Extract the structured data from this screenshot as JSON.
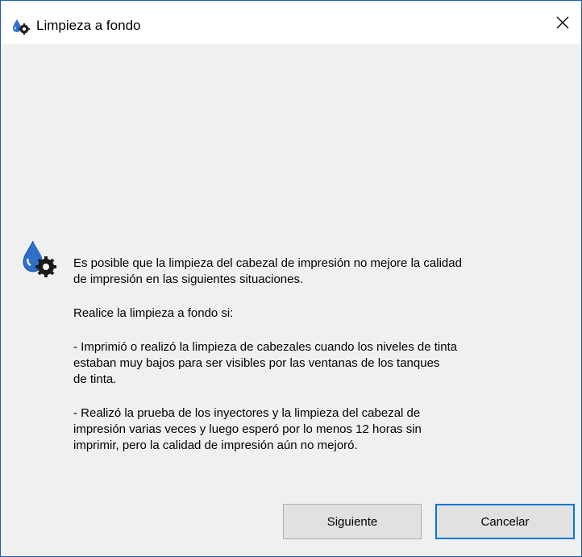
{
  "window": {
    "title": "Limpieza a fondo",
    "title_icon": "printer-cleaning-icon",
    "close_icon": "close-icon"
  },
  "content": {
    "icon": "ink-drop-gear-icon",
    "paragraph1": "Es posible que la limpieza del cabezal de impresión no mejore la calidad\nde impresión en las siguientes situaciones.",
    "paragraph2": "Realice la limpieza a fondo si:",
    "paragraph3": "- Imprimió o realizó la limpieza de cabezales cuando los niveles de tinta\nestaban muy bajos para ser visibles por las ventanas de los tanques\nde tinta.",
    "paragraph4": "- Realizó la prueba de los inyectores y la limpieza del cabezal de\nimpresión varias veces y luego esperó por lo menos 12 horas sin\nimprimir, pero la calidad de impresión aún no mejoró."
  },
  "buttons": {
    "next_label": "Siguiente",
    "cancel_label": "Cancelar"
  },
  "colors": {
    "window_border": "#1a5fb4",
    "dialog_background": "#f0f0f0",
    "focus_accent": "#0078d7"
  }
}
